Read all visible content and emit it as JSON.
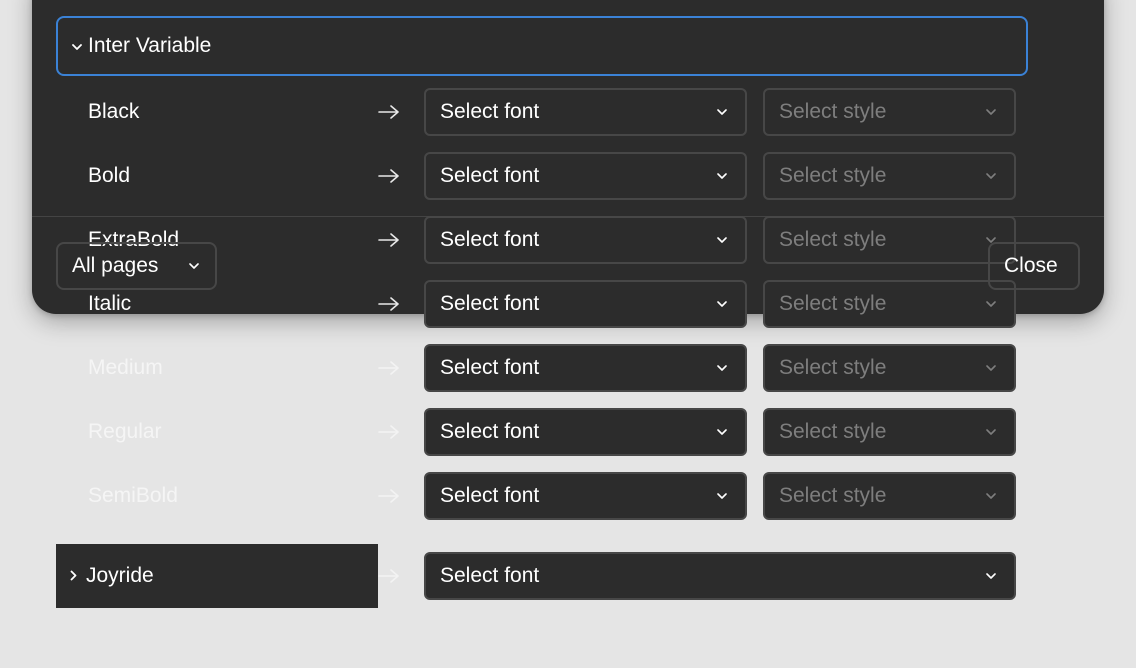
{
  "families": [
    {
      "name": "Inter Variable",
      "expanded": true,
      "chevron_icon": "chevron-down-icon",
      "styles": [
        {
          "name": "Black",
          "font_placeholder": "Select font",
          "style_placeholder": "Select style"
        },
        {
          "name": "Bold",
          "font_placeholder": "Select font",
          "style_placeholder": "Select style"
        },
        {
          "name": "ExtraBold",
          "font_placeholder": "Select font",
          "style_placeholder": "Select style"
        },
        {
          "name": "Italic",
          "font_placeholder": "Select font",
          "style_placeholder": "Select style"
        },
        {
          "name": "Medium",
          "font_placeholder": "Select font",
          "style_placeholder": "Select style"
        },
        {
          "name": "Regular",
          "font_placeholder": "Select font",
          "style_placeholder": "Select style"
        },
        {
          "name": "SemiBold",
          "font_placeholder": "Select font",
          "style_placeholder": "Select style"
        }
      ]
    },
    {
      "name": "Joyride",
      "expanded": false,
      "chevron_icon": "chevron-right-icon",
      "font_placeholder": "Select font"
    }
  ],
  "footer": {
    "pages_label": "All pages",
    "close_label": "Close"
  },
  "colors": {
    "accent": "#3b82d6",
    "panel_bg": "#2c2c2c",
    "page_bg": "#e5e5e5",
    "control_border": "#474747",
    "placeholder_muted": "#7e7e7e"
  }
}
